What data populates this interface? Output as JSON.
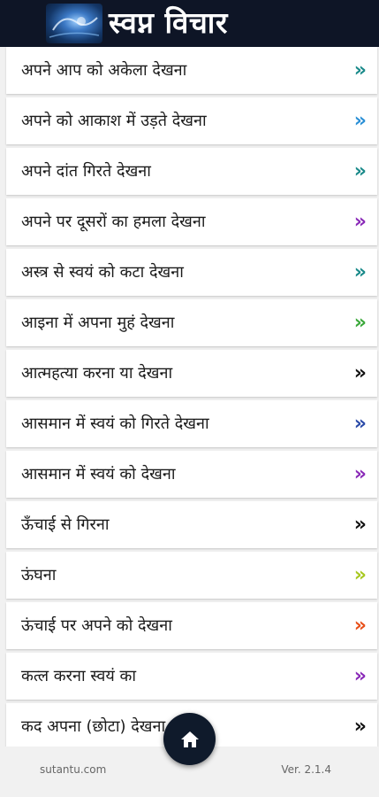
{
  "header": {
    "title": "स्वप्न विचार"
  },
  "items": [
    {
      "label": "अपने आप को अकेला देखना",
      "chevron": "»",
      "color": "#1a8a8a"
    },
    {
      "label": "अपने को आकाश में उड़ते देखना",
      "chevron": "»",
      "color": "#2a8fd6"
    },
    {
      "label": "अपने दांत गिरते देखना",
      "chevron": "»",
      "color": "#1a8a8a"
    },
    {
      "label": "अपने पर दूसरों का हमला देखना",
      "chevron": "»",
      "color": "#8a2ab8"
    },
    {
      "label": "अस्त्र से स्वयं को कटा देखना",
      "chevron": "»",
      "color": "#1a8a8a"
    },
    {
      "label": "आइना में अपना मुहं देखना",
      "chevron": "»",
      "color": "#3aa83a"
    },
    {
      "label": "आत्महत्या करना या देखना",
      "chevron": "»",
      "color": "#111111"
    },
    {
      "label": "आसमान में स्वयं को गिरते देखना",
      "chevron": "»",
      "color": "#2a4aa8"
    },
    {
      "label": "आसमान में स्वयं को देखना",
      "chevron": "»",
      "color": "#8a2ab8"
    },
    {
      "label": "ऊँचाई से गिरना",
      "chevron": "»",
      "color": "#111111"
    },
    {
      "label": "ऊंघना",
      "chevron": "»",
      "color": "#a8c820"
    },
    {
      "label": "ऊंचाई पर अपने को देखना",
      "chevron": "»",
      "color": "#e8501a"
    },
    {
      "label": "कत्ल करना स्वयं का",
      "chevron": "»",
      "color": "#8a2ab8"
    },
    {
      "label": "कद अपना (छोटा)  देखना",
      "chevron": "»",
      "color": "#111111"
    }
  ],
  "footer": {
    "site": "sutantu.com",
    "version": "Ver. 2.1.4"
  },
  "fab": {
    "icon": "home-icon"
  }
}
